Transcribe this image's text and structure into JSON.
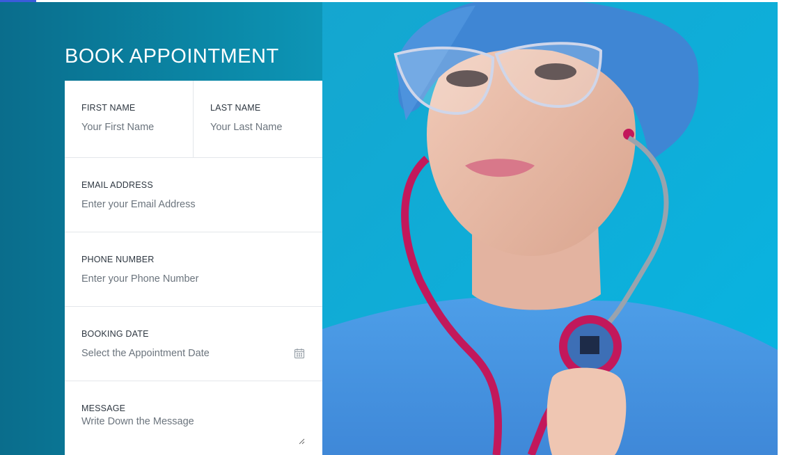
{
  "page": {
    "accent_color": "#3b5bdb"
  },
  "form": {
    "title": "BOOK APPOINTMENT",
    "first_name": {
      "label": "FIRST NAME",
      "placeholder": "Your First Name",
      "value": ""
    },
    "last_name": {
      "label": "LAST NAME",
      "placeholder": "Your Last Name",
      "value": ""
    },
    "email": {
      "label": "EMAIL ADDRESS",
      "placeholder": "Enter your Email Address",
      "value": ""
    },
    "phone": {
      "label": "PHONE NUMBER",
      "placeholder": "Enter your Phone Number",
      "value": ""
    },
    "booking_date": {
      "label": "BOOKING DATE",
      "placeholder": "Select the Appointment Date",
      "value": "",
      "icon": "calendar-icon"
    },
    "message": {
      "label": "MESSAGE",
      "placeholder": "Write Down the Message",
      "value": ""
    }
  },
  "hero": {
    "background_colors": [
      "#0a6d8c",
      "#18b3da"
    ],
    "photo_subject": "doctor-with-stethoscope-image"
  }
}
